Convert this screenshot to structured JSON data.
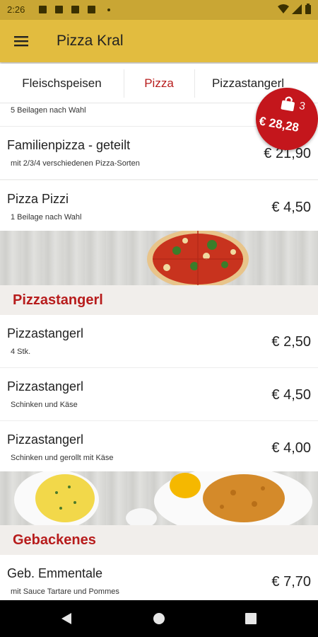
{
  "status_bar": {
    "time": "2:26"
  },
  "app_bar": {
    "title": "Pizza Kral",
    "menu_icon": "menu-icon"
  },
  "tabs": [
    {
      "label": "Fleischspeisen",
      "active": false
    },
    {
      "label": "Pizza",
      "active": true
    },
    {
      "label": "Pizzastangerl",
      "active": false
    }
  ],
  "partial_desc": "5 Beilagen nach Wahl",
  "pizza_items": [
    {
      "name": "Familienpizza - geteilt",
      "desc": "mit 2/3/4 verschiedenen Pizza-Sorten",
      "price": "€ 21,90"
    },
    {
      "name": "Pizza Pizzi",
      "desc": "1 Beilage nach Wahl",
      "price": "€ 4,50"
    }
  ],
  "section_pizzastangerl": "Pizzastangerl",
  "pizzastangerl_items": [
    {
      "name": "Pizzastangerl",
      "desc": "4 Stk.",
      "price": "€ 2,50"
    },
    {
      "name": "Pizzastangerl",
      "desc": "Schinken und Käse",
      "price": "€ 4,50"
    },
    {
      "name": "Pizzastangerl",
      "desc": "Schinken und gerollt mit Käse",
      "price": "€ 4,00"
    }
  ],
  "section_gebackenes": "Gebackenes",
  "gebackenes_items": [
    {
      "name": "Geb. Emmentale",
      "desc": "mit Sauce Tartare und Pommes",
      "price": "€ 7,70"
    }
  ],
  "cart": {
    "count": "3",
    "total": "€ 28,28"
  },
  "colors": {
    "accent": "#e2bc3f",
    "statusbar": "#c9a634",
    "brand_red": "#b71c1c",
    "cart_red": "#c4161c"
  }
}
